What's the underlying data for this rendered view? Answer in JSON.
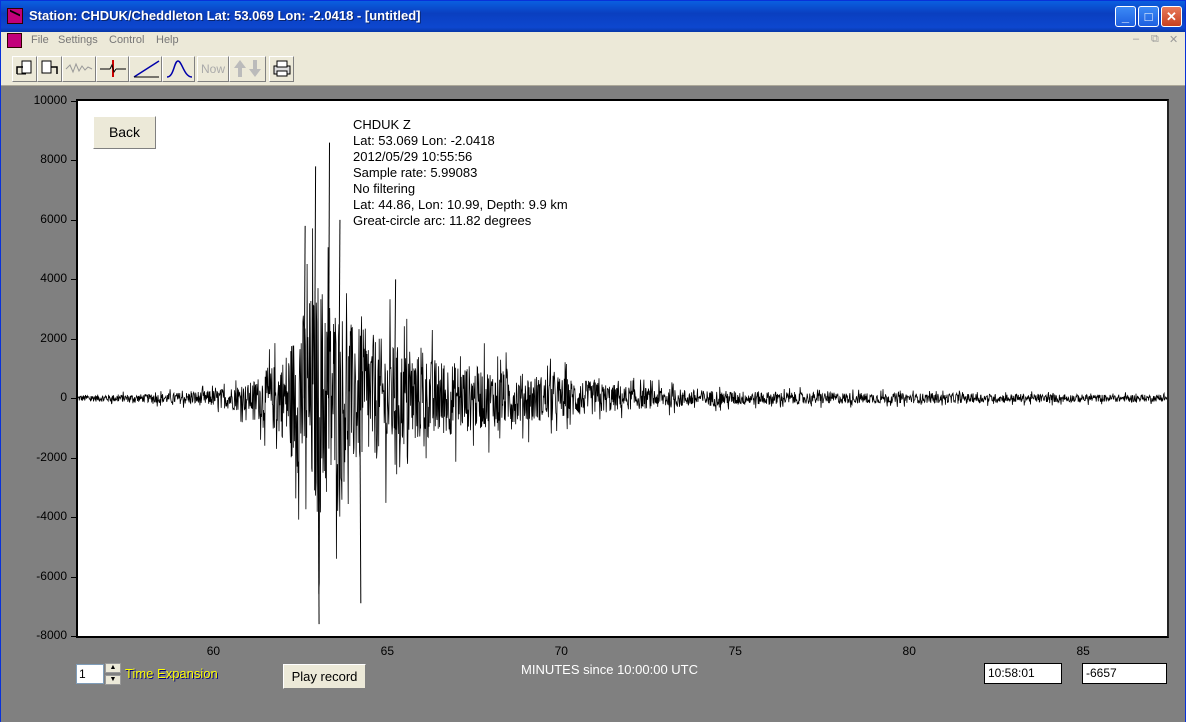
{
  "window": {
    "title": "Station: CHDUK/Cheddleton Lat: 53.069 Lon: -2.0418 - [untitled]"
  },
  "menu": {
    "items": [
      "File",
      "Settings",
      "Control",
      "Help"
    ]
  },
  "toolbar": {
    "now_label": "Now"
  },
  "plot": {
    "back_label": "Back",
    "info_lines": [
      "CHDUK  Z",
      "Lat: 53.069 Lon: -2.0418",
      "2012/05/29 10:55:56",
      "Sample rate: 5.99083",
      "No filtering",
      "Lat: 44.86, Lon: 10.99, Depth: 9.9 km",
      "Great-circle arc: 11.82 degrees"
    ],
    "y_ticks": [
      "10000",
      "8000",
      "6000",
      "4000",
      "2000",
      "0",
      "-2000",
      "-4000",
      "-6000",
      "-8000"
    ],
    "x_ticks": [
      "60",
      "65",
      "70",
      "75",
      "80",
      "85"
    ],
    "x_axis_title": "MINUTES since 10:00:00 UTC"
  },
  "chart_data": {
    "type": "line",
    "xlabel": "MINUTES since 10:00:00 UTC",
    "ylabel": "",
    "xlim": [
      56.1,
      87.4
    ],
    "ylim": [
      -8000,
      10000
    ],
    "series": [
      {
        "envelope_points": [
          [
            56.1,
            200
          ],
          [
            58,
            250
          ],
          [
            59,
            350
          ],
          [
            60,
            500
          ],
          [
            61,
            900
          ],
          [
            62,
            2500
          ],
          [
            62.5,
            5000
          ],
          [
            63,
            7500
          ],
          [
            63.5,
            6000
          ],
          [
            64,
            4500
          ],
          [
            65,
            3500
          ],
          [
            66,
            2600
          ],
          [
            67,
            2200
          ],
          [
            68,
            1800
          ],
          [
            69,
            1500
          ],
          [
            70,
            1300
          ],
          [
            71,
            1000
          ],
          [
            72,
            700
          ],
          [
            74,
            500
          ],
          [
            76,
            400
          ],
          [
            80,
            300
          ],
          [
            84,
            250
          ],
          [
            87.4,
            200
          ]
        ]
      }
    ],
    "peaks": [
      [
        62.9,
        7800
      ],
      [
        63.3,
        8600
      ],
      [
        63.0,
        -7600
      ],
      [
        64.2,
        -6900
      ],
      [
        62.6,
        5800
      ],
      [
        63.6,
        6000
      ],
      [
        65.2,
        4000
      ]
    ]
  },
  "controls": {
    "expansion_value": "1",
    "expansion_label": "Time Expansion",
    "play_label": "Play record",
    "time_readout": "10:58:01",
    "value_readout": "-6657"
  }
}
